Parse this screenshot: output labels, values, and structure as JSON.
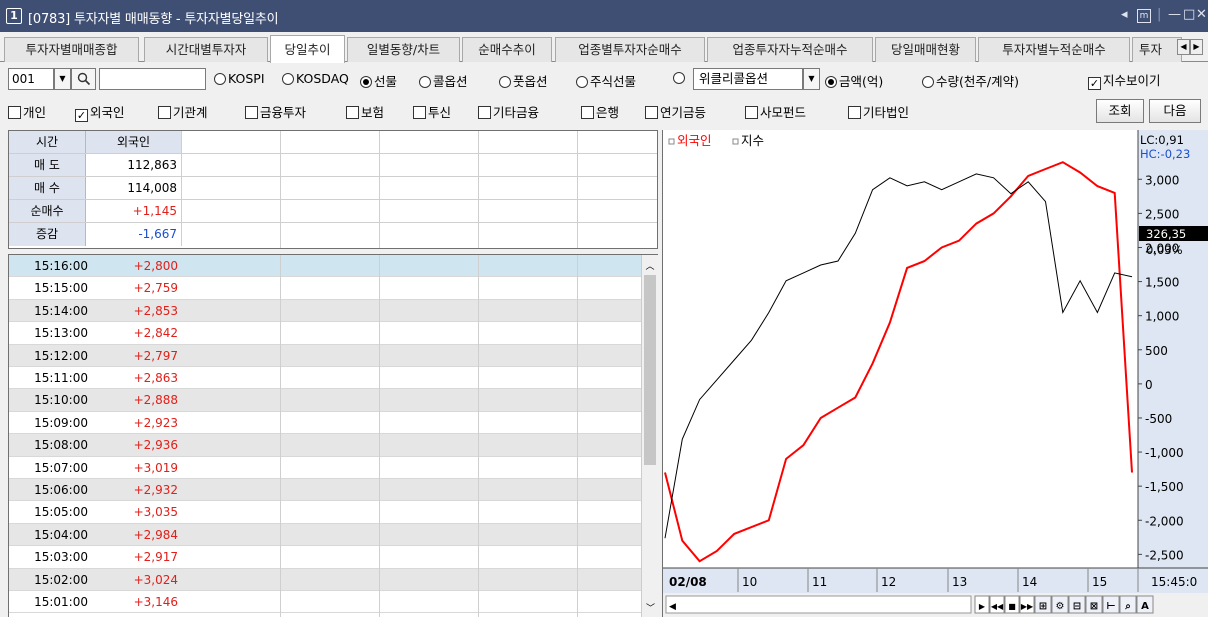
{
  "window": {
    "number": "1",
    "title": "[0783] 투자자별 매매동향 - 투자자별당일추이"
  },
  "tabs": [
    "투자자별매매종합",
    "시간대별투자자",
    "당일추이",
    "일별동향/차트",
    "순매수추이",
    "업종별투자자순매수",
    "업종투자자누적순매수",
    "당일매매현황",
    "투자자별누적순매수",
    "투자"
  ],
  "active_tab": 2,
  "controls": {
    "code_value": "001",
    "market_radios": [
      "KOSPI",
      "KOSDAQ",
      "선물",
      "콜옵션",
      "풋옵션",
      "주식선물",
      "위클리콜옵션"
    ],
    "market_selected": 2,
    "unit_radios": [
      "금액(억)",
      "수량(천주/계약)"
    ],
    "unit_selected": 0,
    "show_index_label": "지수보이기",
    "investor_checks": [
      "개인",
      "외국인",
      "기관계",
      "금융투자",
      "보험",
      "투신",
      "기타금융",
      "은행",
      "연기금등",
      "사모펀드",
      "기타법인"
    ],
    "investor_checked": 1,
    "query_button": "조회",
    "next_button": "다음"
  },
  "summary": {
    "headers": [
      "시간",
      "외국인"
    ],
    "rows": [
      {
        "label": "매 도",
        "value": "112,863",
        "color": "#000000"
      },
      {
        "label": "매 수",
        "value": "114,008",
        "color": "#000000"
      },
      {
        "label": "순매수",
        "value": "+1,145",
        "color": "#e0201a"
      },
      {
        "label": "증감",
        "value": "-1,667",
        "color": "#1a4fd0"
      }
    ]
  },
  "list": [
    {
      "time": "15:16:00",
      "value": "+2,800"
    },
    {
      "time": "15:15:00",
      "value": "+2,759"
    },
    {
      "time": "15:14:00",
      "value": "+2,853"
    },
    {
      "time": "15:13:00",
      "value": "+2,842"
    },
    {
      "time": "15:12:00",
      "value": "+2,797"
    },
    {
      "time": "15:11:00",
      "value": "+2,863"
    },
    {
      "time": "15:10:00",
      "value": "+2,888"
    },
    {
      "time": "15:09:00",
      "value": "+2,923"
    },
    {
      "time": "15:08:00",
      "value": "+2,936"
    },
    {
      "time": "15:07:00",
      "value": "+3,019"
    },
    {
      "time": "15:06:00",
      "value": "+2,932"
    },
    {
      "time": "15:05:00",
      "value": "+3,035"
    },
    {
      "time": "15:04:00",
      "value": "+2,984"
    },
    {
      "time": "15:03:00",
      "value": "+2,917"
    },
    {
      "time": "15:02:00",
      "value": "+3,024"
    },
    {
      "time": "15:01:00",
      "value": "+3,146"
    }
  ],
  "chart": {
    "legend": [
      "외국인",
      "지수"
    ],
    "lc_label": "LC:0,91",
    "hc_label": "HC:-0,23",
    "current_value": "326,35",
    "current_pct": "0,03%",
    "y_ticks": [
      "3,000",
      "2,500",
      "2,000",
      "1,500",
      "1,000",
      "500",
      "0",
      "-500",
      "-1,000",
      "-1,500",
      "-2,000",
      "-2,500"
    ],
    "x_ticks": [
      "02/08",
      "10",
      "11",
      "12",
      "13",
      "14",
      "15"
    ],
    "last_time": "15:45:0",
    "colors": {
      "foreign": "#ff0000",
      "index": "#000000",
      "axis_bg": "#dde6f2"
    }
  },
  "chart_data": {
    "type": "line",
    "x": [
      "09:00",
      "09:15",
      "09:30",
      "09:45",
      "10:00",
      "10:15",
      "10:30",
      "10:45",
      "11:00",
      "11:15",
      "11:30",
      "11:45",
      "12:00",
      "12:15",
      "12:30",
      "12:45",
      "13:00",
      "13:15",
      "13:30",
      "13:45",
      "14:00",
      "14:15",
      "14:30",
      "14:45",
      "15:00",
      "15:15",
      "15:30",
      "15:45"
    ],
    "series": [
      {
        "name": "외국인",
        "values": [
          -1300,
          -2300,
          -2600,
          -2450,
          -2200,
          -2100,
          -2000,
          -1100,
          -900,
          -500,
          -350,
          -200,
          300,
          900,
          1700,
          1800,
          2000,
          2100,
          2350,
          2500,
          2750,
          3050,
          3150,
          3250,
          3100,
          2900,
          2800,
          -1300
        ]
      }
    ],
    "y2_series": [
      {
        "name": "지수",
        "values": [
          0.05,
          0.3,
          0.4,
          0.45,
          0.5,
          0.55,
          0.62,
          0.7,
          0.72,
          0.74,
          0.75,
          0.82,
          0.93,
          0.96,
          0.94,
          0.95,
          0.93,
          0.95,
          0.97,
          0.96,
          0.92,
          0.95,
          0.9,
          0.62,
          0.7,
          0.62,
          0.72,
          0.71
        ]
      }
    ],
    "ylim": [
      -2700,
      3400
    ]
  }
}
